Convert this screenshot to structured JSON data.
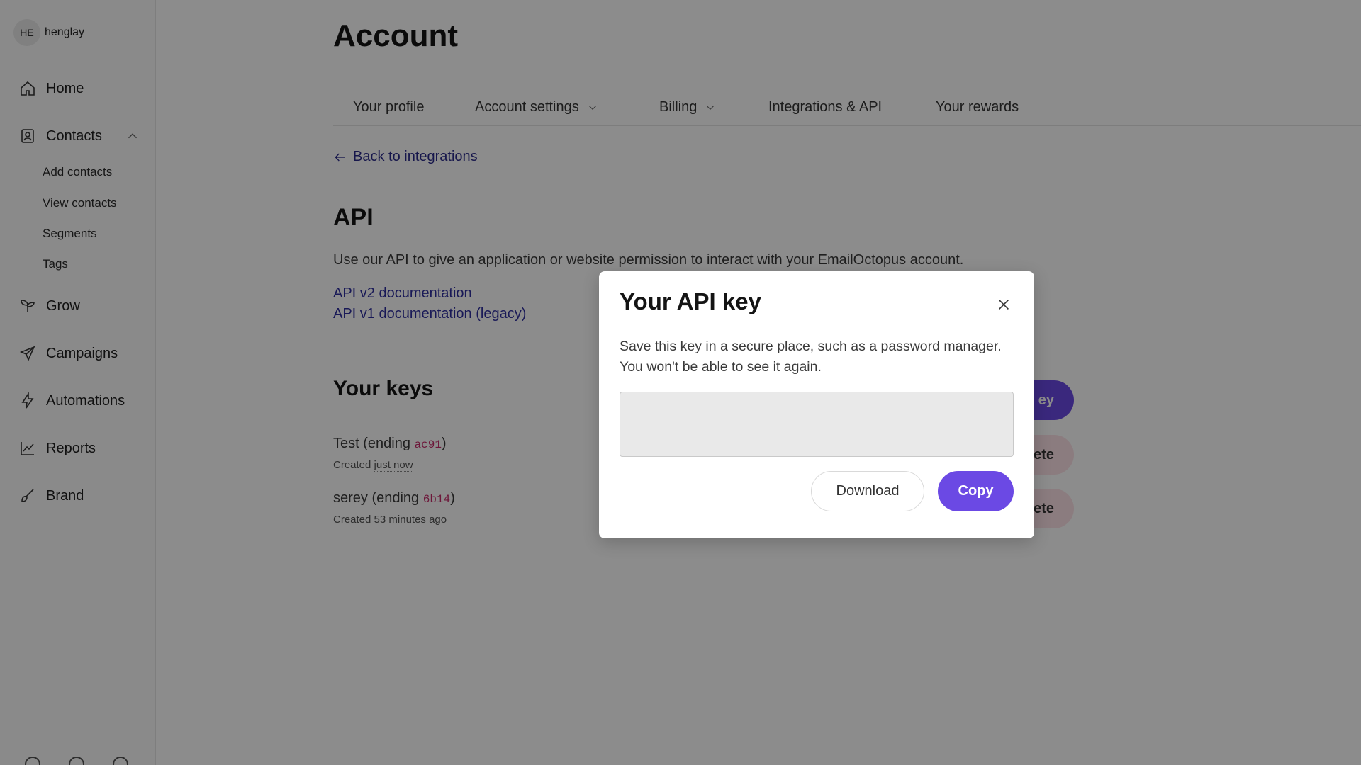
{
  "sidebar": {
    "user": {
      "initials": "HE",
      "name": "henglay"
    },
    "nav": {
      "home": "Home",
      "contacts": "Contacts",
      "grow": "Grow",
      "campaigns": "Campaigns",
      "automations": "Automations",
      "reports": "Reports",
      "brand": "Brand"
    },
    "contacts_sub": {
      "add": "Add contacts",
      "view": "View contacts",
      "segments": "Segments",
      "tags": "Tags"
    }
  },
  "header": {
    "title": "Account"
  },
  "tabs": {
    "profile": "Your profile",
    "account_settings": "Account settings",
    "billing": "Billing",
    "integrations": "Integrations & API",
    "rewards": "Your rewards"
  },
  "back_link": "Back to integrations",
  "api": {
    "title": "API",
    "description": "Use our API to give an application or website permission to interact with your EmailOctopus account.",
    "doc_v2": "API v2 documentation",
    "doc_v1": "API v1 documentation (legacy)"
  },
  "keys": {
    "title": "Your keys",
    "create_btn_partial": "ey",
    "delete_btn_partial": "ete",
    "items": [
      {
        "name_prefix": "Test (ending ",
        "suffix": "ac91",
        "close": ")",
        "created_prefix": "Created ",
        "created_when": "just now"
      },
      {
        "name_prefix": "serey (ending ",
        "suffix": "6b14",
        "close": ")",
        "created_prefix": "Created ",
        "created_when": "53 minutes ago"
      }
    ]
  },
  "modal": {
    "title": "Your API key",
    "text": "Save this key in a secure place, such as a password manager. You won't be able to see it again.",
    "download": "Download",
    "copy": "Copy"
  },
  "colors": {
    "accent": "#6b49e4",
    "link": "#2f2f9f",
    "key_suffix": "#c72b6a"
  }
}
